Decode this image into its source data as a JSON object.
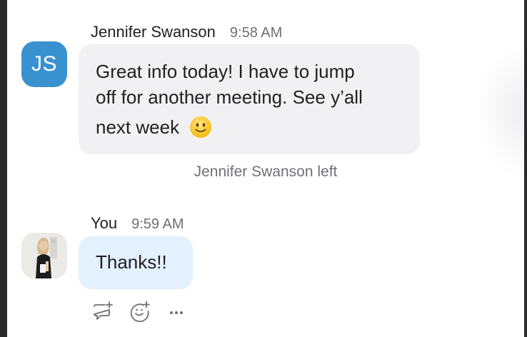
{
  "messages": [
    {
      "sender": "Jennifer Swanson",
      "time": "9:58 AM",
      "avatar_initials": "JS",
      "avatar_color": "#3a91cf",
      "lines": [
        "Great info today! I have to jump",
        "off for another meeting. See y’all",
        "next week"
      ],
      "emoji": "slightly-smiling-face-icon"
    },
    {
      "sender": "You",
      "time": "9:59 AM",
      "avatar": "user-photo",
      "text": "Thanks!!"
    }
  ],
  "system_note": "Jennifer Swanson left",
  "actions": [
    "reply-icon",
    "add-reaction-icon",
    "more-icon"
  ],
  "colors": {
    "incoming_bubble": "#f1f1f4",
    "outgoing_bubble": "#e3f0fd",
    "secondary_text": "#6f6f78"
  }
}
